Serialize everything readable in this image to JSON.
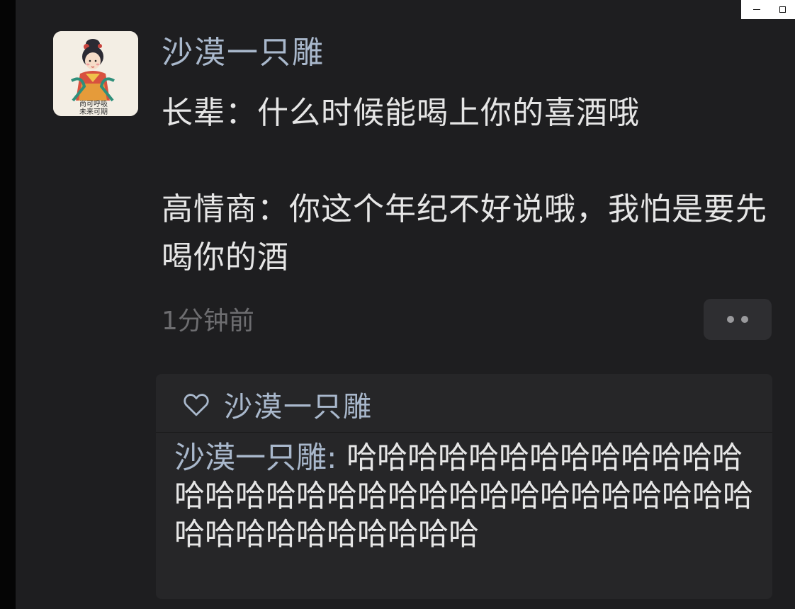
{
  "window": {
    "minimize_label": "",
    "maximize_label": ""
  },
  "post": {
    "avatar": {
      "icon": "illustrated-girl-avatar",
      "caption_line1": "尚可呼吸",
      "caption_line2": "未来可期"
    },
    "username": "沙漠一只雕",
    "lines": [
      "长辈：什么时候能喝上你的喜酒哦",
      "高情商：你这个年纪不好说哦，我怕是要先喝你的酒"
    ],
    "timestamp": "1分钟前",
    "more_icon": "more-dots-icon"
  },
  "comments": {
    "like": {
      "icon": "heart-outline-icon",
      "name": "沙漠一只雕"
    },
    "items": [
      {
        "author": "沙漠一只雕",
        "separator": ": ",
        "text": "哈哈哈哈哈哈哈哈哈哈哈哈哈哈哈哈哈哈哈哈哈哈哈哈哈哈哈哈哈哈哈哈哈哈哈哈哈哈哈哈哈哈"
      }
    ]
  },
  "colors": {
    "background": "#1e1e20",
    "username": "#a9b8cc",
    "text": "#e6e6e6",
    "muted": "#6d6d70",
    "panel": "#262628"
  }
}
